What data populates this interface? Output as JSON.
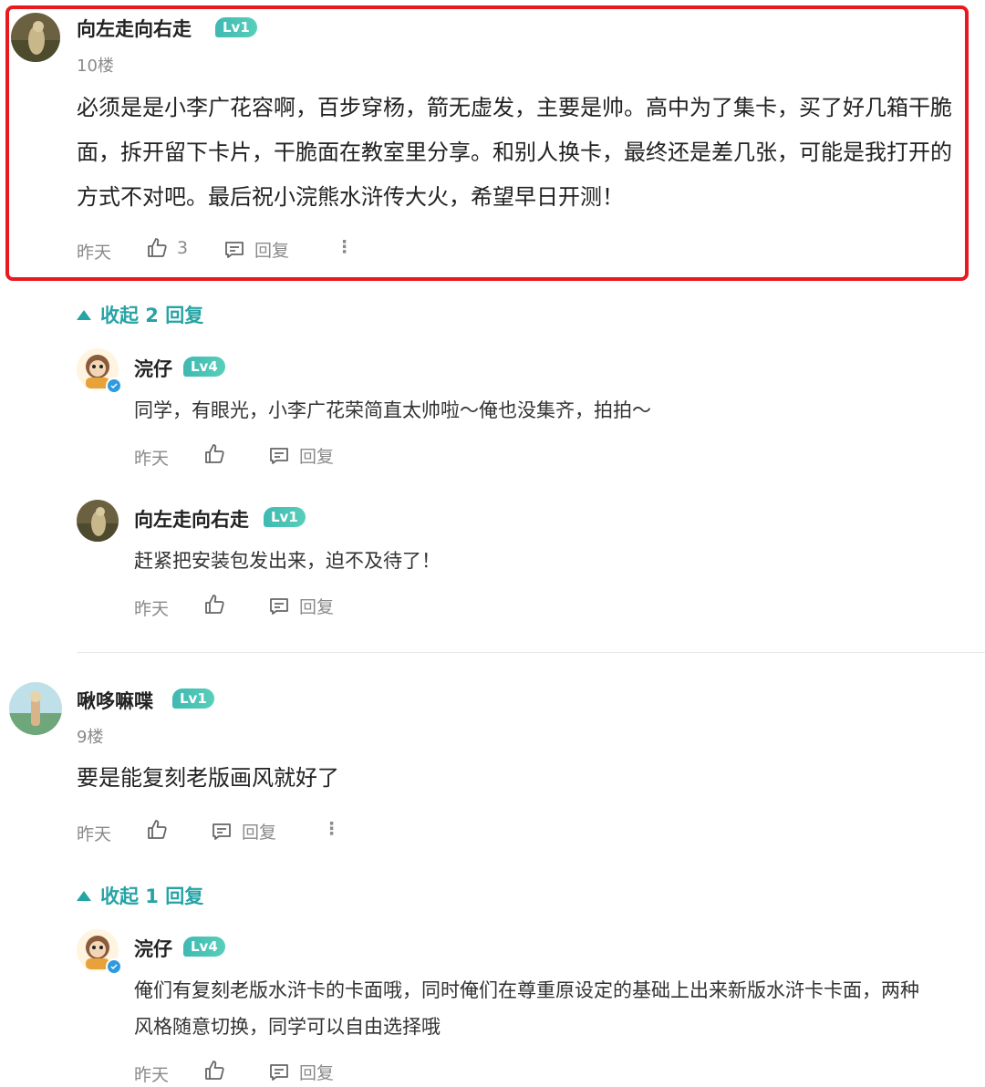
{
  "comments": [
    {
      "user": "向左走向右走",
      "level": "Lv1",
      "floor": "10楼",
      "text": "必须是是小李广花容啊，百步穿杨，箭无虚发，主要是帅。高中为了集卡，买了好几箱干脆面，拆开留下卡片，干脆面在教室里分享。和别人换卡，最终还是差几张，可能是我打开的方式不对吧。最后祝小浣熊水浒传大火，希望早日开测！",
      "time": "昨天",
      "likes": "3",
      "reply_label": "回复",
      "more": "⋮",
      "collapse_label": "收起 2 回复",
      "replies": [
        {
          "user": "浣仔",
          "level": "Lv4",
          "text": "同学，有眼光，小李广花荣简直太帅啦～俺也没集齐，拍拍～",
          "time": "昨天",
          "reply_label": "回复"
        },
        {
          "user": "向左走向右走",
          "level": "Lv1",
          "text": "赶紧把安装包发出来，迫不及待了！",
          "time": "昨天",
          "reply_label": "回复"
        }
      ]
    },
    {
      "user": "啾哆嘛喋",
      "level": "Lv1",
      "floor": "9楼",
      "text": "要是能复刻老版画风就好了",
      "time": "昨天",
      "reply_label": "回复",
      "more": "⋮",
      "collapse_label": "收起 1 回复",
      "replies": [
        {
          "user": "浣仔",
          "level": "Lv4",
          "text": "俺们有复刻老版水浒卡的卡面哦，同时俺们在尊重原设定的基础上出来新版水浒卡卡面，两种风格随意切换，同学可以自由选择哦",
          "time": "昨天",
          "reply_label": "回复"
        }
      ]
    }
  ],
  "colors": {
    "accent": "#26a3a5",
    "highlight": "#e8191f",
    "level_badge": "#3fb9b2"
  },
  "icons": [
    "thumb-up-icon",
    "comment-icon",
    "more-icon",
    "collapse-triangle-icon",
    "verified-icon"
  ]
}
